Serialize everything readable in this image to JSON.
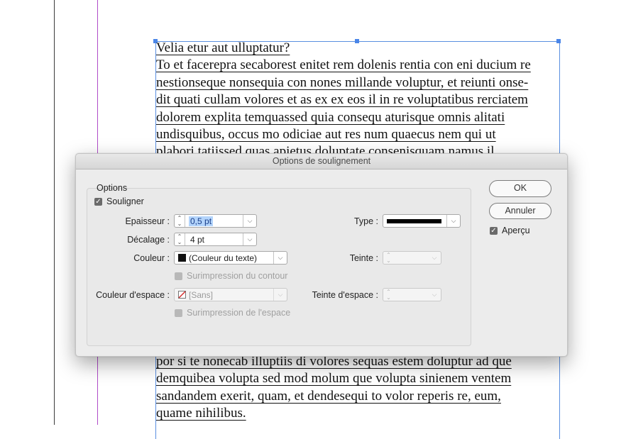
{
  "document": {
    "top_lines": [
      "Velia etur aut ulluptatur?",
      "To et facerepra secaborest enitet rem dolenis rentia con eni ducium re",
      "nestionseque nonsequia con nones millande voluptur, et reiunti onse-",
      "dit quati cullam volores et as ex ex eos il in re voluptatibus rerciatem",
      "dolorem explita temquassed quia consequ aturisque omnis alitati",
      "undisquibus, occus mo odiciae aut res num quaecus nem qui ut",
      "plabori tatiissed quas apietus doluptate consenisquam namus il"
    ],
    "bottom_lines": [
      "por si te nonecab illuptiis di volores sequas estem doluptur ad que",
      "demquibea volupta sed mod molum que volupta sinienem ventem",
      "sandandem exerit, quam, et dendesequi to volor reperis re, eum,",
      "quame nihilibus."
    ]
  },
  "dialog": {
    "title": "Options de soulignement",
    "group_label": "Options",
    "souligner": {
      "label": "Souligner",
      "checked": true
    },
    "epaisseur": {
      "label": "Epaisseur :",
      "value": "0,5 pt"
    },
    "decalage": {
      "label": "Décalage :",
      "value": "4 pt"
    },
    "couleur": {
      "label": "Couleur :",
      "value": "(Couleur du texte)",
      "swatch": "#111111"
    },
    "surimpression_contour": {
      "label": "Surimpression du contour",
      "checked": false,
      "enabled": false
    },
    "couleur_espace": {
      "label": "Couleur d'espace :",
      "value": "[Sans]"
    },
    "surimpression_espace": {
      "label": "Surimpression de l'espace",
      "checked": false,
      "enabled": false
    },
    "type": {
      "label": "Type :"
    },
    "teinte": {
      "label": "Teinte :",
      "value": ""
    },
    "teinte_espace": {
      "label": "Teinte d'espace :",
      "value": ""
    },
    "buttons": {
      "ok": "OK",
      "annuler": "Annuler"
    },
    "apercu": {
      "label": "Aperçu",
      "checked": true
    }
  }
}
